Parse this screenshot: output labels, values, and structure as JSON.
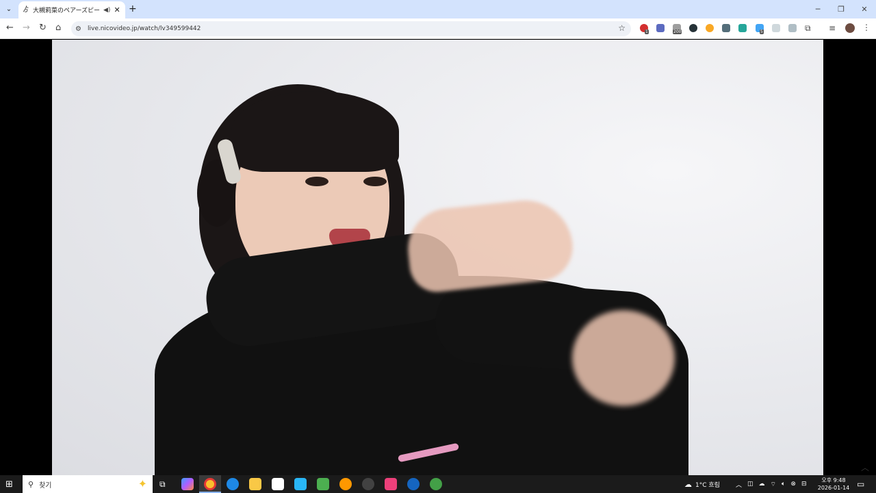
{
  "browser": {
    "tab_title": "大槻莉菜のペアーズピーアンビ",
    "url": "live.nicovideo.jp/watch/lv349599442",
    "extension_badges": [
      "1",
      "200",
      "5"
    ]
  },
  "taskbar": {
    "search_placeholder": "찾기",
    "weather": "1°C 흐림",
    "time": "오후 9:48",
    "date": "2026-01-14"
  }
}
